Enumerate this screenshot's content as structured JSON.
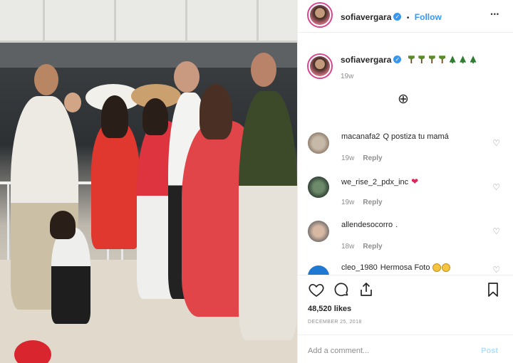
{
  "header": {
    "username": "sofiavergara",
    "verified": "✓",
    "separator": "•",
    "follow_label": "Follow",
    "more_label": "•••"
  },
  "caption": {
    "username": "sofiavergara",
    "emojis": [
      "palm-tree",
      "palm-tree",
      "palm-tree",
      "palm-tree",
      "christmas-tree",
      "christmas-tree",
      "christmas-tree"
    ],
    "time": "19w"
  },
  "load_more": "⊕",
  "comments": [
    {
      "username": "macanafa2",
      "text": "Q postiza tu mamá",
      "time": "19w",
      "reply": "Reply"
    },
    {
      "username": "we_rise_2_pdx_inc",
      "text": "",
      "emoji": "❤",
      "time": "19w",
      "reply": "Reply"
    },
    {
      "username": "allendesocorro",
      "text": ".",
      "time": "18w",
      "reply": "Reply"
    },
    {
      "username": "cleo_1980",
      "text": "Hermosa Foto",
      "emoji": "clapping-hands",
      "time": "",
      "reply": ""
    }
  ],
  "likes": "48,520 likes",
  "date": "DECEMBER 25, 2018",
  "add_comment_placeholder": "Add a comment...",
  "post_label": "Post",
  "colors": {
    "link": "#3897f0",
    "muted": "#8e8e8e",
    "text": "#262626",
    "post_disabled": "#b2dffc",
    "story_ring": "#d8468f"
  }
}
